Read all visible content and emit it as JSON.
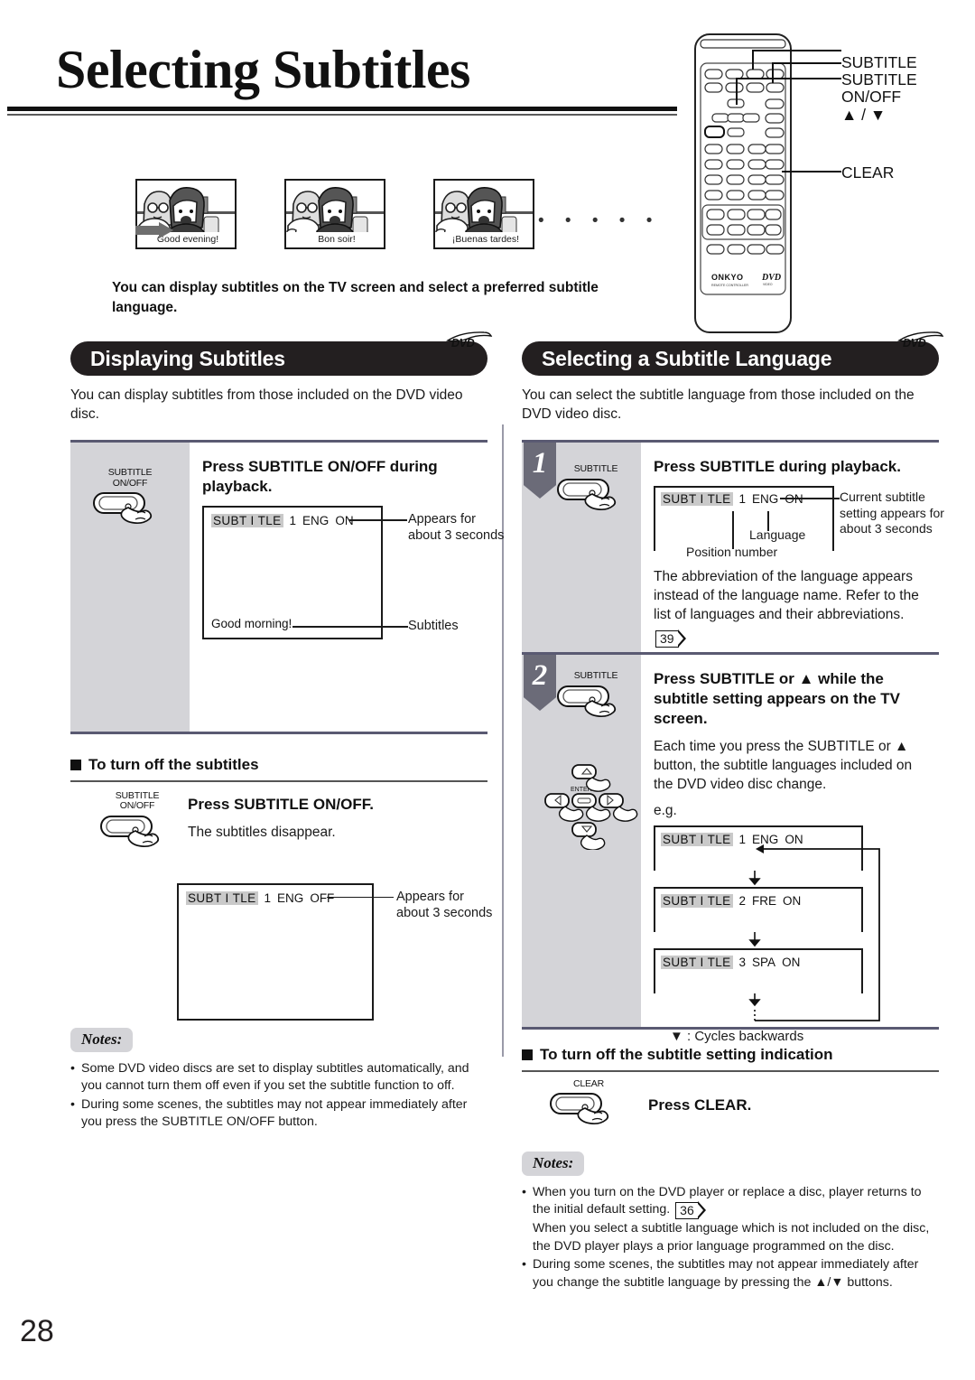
{
  "page": {
    "title": "Selecting Subtitles",
    "number": "28",
    "intro": "You can display subtitles on the TV screen and select a preferred subtitle language."
  },
  "comic": {
    "panels": [
      {
        "caption": "Good evening!",
        "lang": "english"
      },
      {
        "caption": "Bon soir!",
        "lang": "french"
      },
      {
        "caption": "¡Buenas tardes!",
        "lang": "spanish"
      }
    ],
    "ellipsis": "• • • • •"
  },
  "remote": {
    "brand": "ONKYO",
    "brand_sub": "REMOTE CONTROLLER",
    "disc_logo": "DVD",
    "disc_logo_sub": "VIDEO",
    "callouts": [
      {
        "label": "SUBTITLE"
      },
      {
        "label": "SUBTITLE"
      },
      {
        "label": "ON/OFF"
      },
      {
        "label": "▲ / ▼"
      },
      {
        "label": "CLEAR"
      }
    ]
  },
  "left": {
    "header": {
      "title": "Displaying Subtitles",
      "badge": "DVD"
    },
    "description": "You can display subtitles from those included on the DVD video disc.",
    "step": {
      "button_label": "SUBTITLE\nON/OFF",
      "title": "Press SUBTITLE ON/OFF during playback.",
      "osd": {
        "tag": "SUBT I TLE",
        "position": "1",
        "language": "ENG",
        "state": "ON"
      },
      "subtitle_line": "Good   morning!",
      "callout_top": "Appears for\nabout 3 seconds",
      "callout_bottom": "Subtitles"
    },
    "turnoff": {
      "heading": "To turn off the subtitles",
      "button_label": "SUBTITLE\nON/OFF",
      "title": "Press SUBTITLE ON/OFF.",
      "text": "The subtitles disappear.",
      "osd": {
        "tag": "SUBT I TLE",
        "position": "1",
        "language": "ENG",
        "state": "OFF"
      },
      "callout_top": "Appears for\nabout 3 seconds"
    },
    "notes": {
      "tag": "Notes:",
      "items": [
        "Some DVD video discs are set to display subtitles automatically, and you cannot turn them off even if you set the subtitle function to off.",
        "During some scenes, the subtitles may not appear immediately after you press the SUBTITLE ON/OFF button."
      ]
    }
  },
  "right": {
    "header": {
      "title": "Selecting a Subtitle Language",
      "badge": "DVD"
    },
    "description": "You can select the subtitle language from those included on the DVD video disc.",
    "step1": {
      "number": "1",
      "button_label": "SUBTITLE",
      "title": "Press SUBTITLE during playback.",
      "osd": {
        "tag": "SUBT I TLE",
        "position": "1",
        "language": "ENG",
        "state": "ON"
      },
      "label_language": "Language",
      "label_position": "Position number",
      "callout": "Current subtitle setting appears for about 3 seconds",
      "text": "The abbreviation of the language appears instead of the language name. Refer to the list of languages and their abbreviations.",
      "pageref": "39"
    },
    "step2": {
      "number": "2",
      "button_label": "SUBTITLE",
      "dpad_label": "ENTER",
      "title": "Press SUBTITLE or ▲ while the subtitle setting appears on the TV screen.",
      "text": "Each time you press the SUBTITLE or ▲ button, the subtitle languages included on the DVD video disc change.",
      "eg": "e.g.",
      "cycle": [
        {
          "tag": "SUBT I TLE",
          "position": "1",
          "language": "ENG",
          "state": "ON"
        },
        {
          "tag": "SUBT I TLE",
          "position": "2",
          "language": "FRE",
          "state": "ON"
        },
        {
          "tag": "SUBT I TLE",
          "position": "3",
          "language": "SPA",
          "state": "ON"
        }
      ],
      "cycle_caption": "▼ : Cycles backwards"
    },
    "turnoff": {
      "heading": "To turn off the subtitle setting indication",
      "button_label": "CLEAR",
      "title": "Press CLEAR."
    },
    "notes": {
      "tag": "Notes:",
      "item1_a": "When you turn on the DVD player or replace a disc, player returns to the initial default setting.",
      "item1_ref": "36",
      "item1_b": "When you select a subtitle language which is not included on the disc, the DVD player plays a prior language programmed on the disc.",
      "item2": "During some scenes, the subtitles may not appear immediately after you change the subtitle language by pressing the ▲/▼ buttons."
    }
  }
}
